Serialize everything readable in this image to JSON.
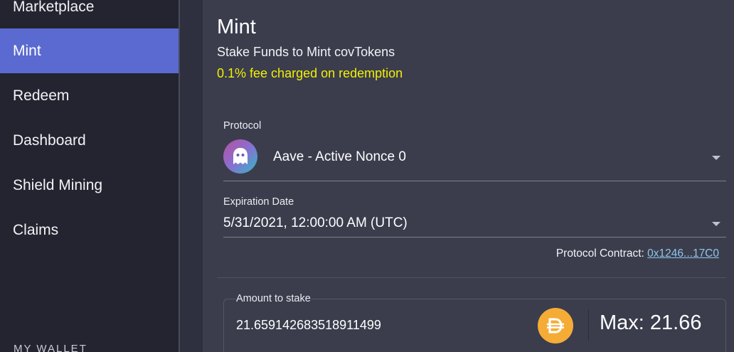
{
  "sidebar": {
    "items": [
      {
        "label": "Marketplace",
        "active": false
      },
      {
        "label": "Mint",
        "active": true
      },
      {
        "label": "Redeem",
        "active": false
      },
      {
        "label": "Dashboard",
        "active": false
      },
      {
        "label": "Shield Mining",
        "active": false
      },
      {
        "label": "Claims",
        "active": false
      }
    ],
    "wallet_label": "MY WALLET"
  },
  "main": {
    "title": "Mint",
    "subtitle": "Stake Funds to Mint covTokens",
    "fee_note": "0.1% fee charged on redemption",
    "protocol": {
      "label": "Protocol",
      "value": "Aave - Active Nonce 0",
      "icon": "aave-ghost-icon"
    },
    "expiration": {
      "label": "Expiration Date",
      "value": "5/31/2021, 12:00:00 AM (UTC)"
    },
    "contract": {
      "label": "Protocol Contract: ",
      "link": "0x1246...17C0"
    },
    "stake": {
      "label": "Amount to stake",
      "value": "21.659142683518911499",
      "token_icon": "dai-icon",
      "max_label": "Max: 21.66"
    }
  },
  "colors": {
    "sidebar_bg": "#23242f",
    "active_item": "#5b6ad0",
    "main_bg": "#3b3d4d",
    "fee_note": "#f2f000",
    "link": "#8fc6ea",
    "dai": "#f5ac37"
  }
}
